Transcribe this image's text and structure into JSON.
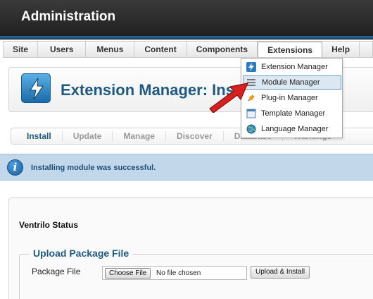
{
  "header": {
    "title": "Administration"
  },
  "menubar": {
    "items": [
      {
        "label": "Site"
      },
      {
        "label": "Users"
      },
      {
        "label": "Menus"
      },
      {
        "label": "Content"
      },
      {
        "label": "Components"
      },
      {
        "label": "Extensions"
      },
      {
        "label": "Help"
      }
    ],
    "active": "Extensions"
  },
  "toolbar": {
    "icon": "lightning-icon",
    "title": "Extension Manager: Install"
  },
  "subnav": {
    "tabs": [
      {
        "label": "Install"
      },
      {
        "label": "Update"
      },
      {
        "label": "Manage"
      },
      {
        "label": "Discover"
      },
      {
        "label": "Database"
      },
      {
        "label": "Warnings"
      }
    ],
    "active": "Install"
  },
  "message": {
    "icon": "info-icon",
    "text": "Installing module was successful."
  },
  "module": {
    "title": "Ventrilo Status"
  },
  "upload": {
    "legend": "Upload Package File",
    "field_label": "Package File",
    "choose_button": "Choose File",
    "no_file_text": "No file chosen",
    "submit_button": "Upload & Install"
  },
  "dropdown": {
    "items": [
      {
        "label": "Extension Manager",
        "icon": "lightning-icon"
      },
      {
        "label": "Module Manager",
        "icon": "module-icon"
      },
      {
        "label": "Plug-in Manager",
        "icon": "plug-icon"
      },
      {
        "label": "Template Manager",
        "icon": "template-icon"
      },
      {
        "label": "Language Manager",
        "icon": "globe-icon"
      }
    ],
    "highlighted": "Module Manager"
  },
  "colors": {
    "accent_blue": "#1e5a82",
    "arrow_red": "#d82020",
    "message_bg": "#c2d8ea"
  }
}
